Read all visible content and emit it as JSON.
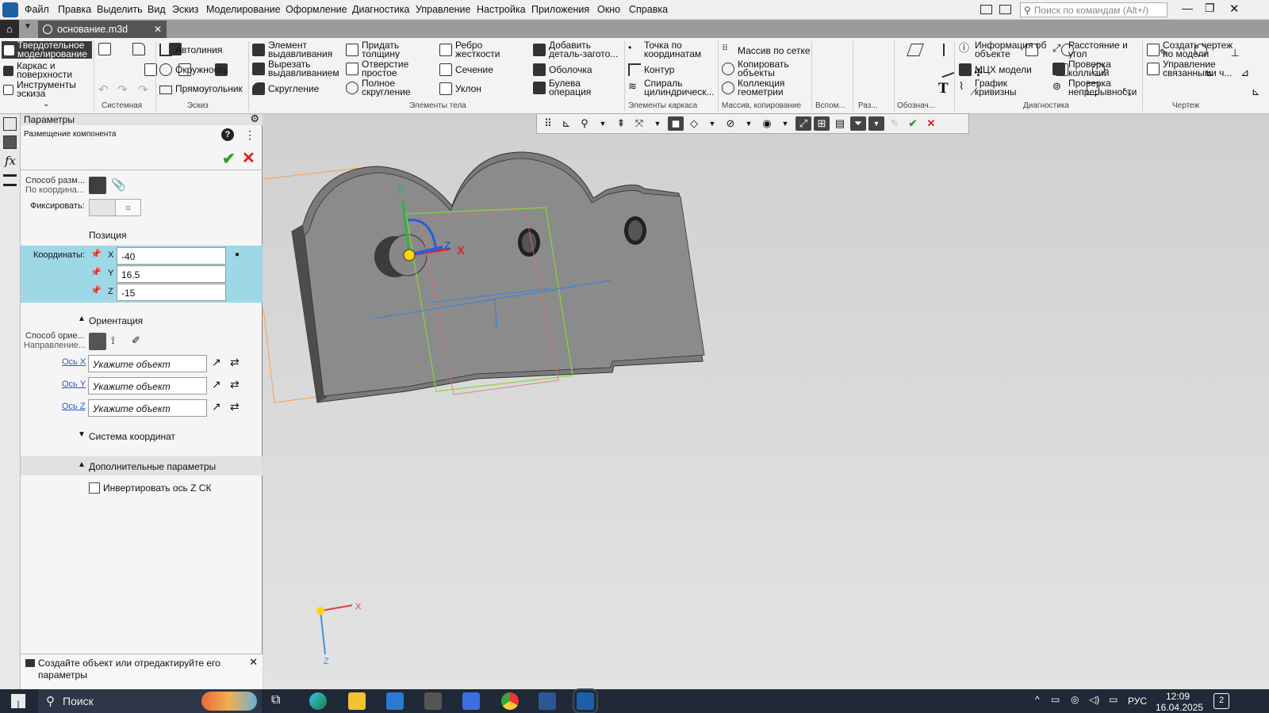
{
  "menu": [
    "Файл",
    "Правка",
    "Выделить",
    "Вид",
    "Эскиз",
    "Моделирование",
    "Оформление",
    "Диагностика",
    "Управление",
    "Настройка",
    "Приложения",
    "Окно",
    "Справка"
  ],
  "search_placeholder": "Поиск по командам (Alt+/)",
  "doc_tab": "основание.m3d",
  "ribbon": {
    "modes": [
      "Твердотельное моделирование",
      "Каркас и поверхности",
      "Инструменты эскиза"
    ],
    "sketch": [
      "Автолиния",
      "Окружность",
      "Прямоугольник"
    ],
    "body1": [
      "Элемент выдавливания",
      "Вырезать выдавливанием",
      "Скругление"
    ],
    "body2": [
      "Придать толщину",
      "Отверстие простое",
      "Полное скругление"
    ],
    "body3": [
      "Ребро жесткости",
      "Сечение",
      "Уклон"
    ],
    "body4": [
      "Добавить деталь-загото...",
      "Оболочка",
      "Булева операция"
    ],
    "wire": [
      "Точка по координатам",
      "Контур",
      "Спираль цилиндрическ..."
    ],
    "array": [
      "Массив по сетке",
      "Копировать объекты",
      "Коллекция геометрии"
    ],
    "diag1": [
      "Информация об объекте",
      "МЦХ модели",
      "График кривизны"
    ],
    "diag2": [
      "Расстояние и угол",
      "Проверка коллизий",
      "Проверка непрерывности"
    ],
    "drawing": [
      "Создать чертеж по модели",
      "Управление связанными ч..."
    ],
    "groups": [
      "Системная",
      "Эскиз",
      "Элементы тела",
      "Элементы каркаса",
      "Массив, копирование",
      "Вспом...",
      "Раз...",
      "Обознач...",
      "Диагностика",
      "Чертеж"
    ]
  },
  "panel": {
    "title": "Параметры",
    "subtitle": "Размещение компонента",
    "placement_label": "Способ разм...",
    "placement_value": "По координа...",
    "fix_label": "Фиксировать:",
    "position_header": "Позиция",
    "coords_label": "Координаты:",
    "coords": {
      "x_axis": "X",
      "x": "-40",
      "y_axis": "Y",
      "y": "16.5",
      "z_axis": "Z",
      "z": "-15"
    },
    "orientation_header": "Ориентация",
    "orient_label": "Способ орие...",
    "orient_value": "Направление...",
    "axes": [
      "Ось X",
      "Ось Y",
      "Ось Z"
    ],
    "axis_placeholder": "Укажите объект",
    "cs_header": "Система координат",
    "extra_header": "Дополнительные параметры",
    "invert_label": "Инвертировать ось Z СК",
    "hint": "Создайте объект или отредактируйте его параметры"
  },
  "viewport": {
    "axis_y": "Y",
    "axis_x": "X",
    "axis_z": "Z",
    "mini_x": "X",
    "mini_z": "Z"
  },
  "taskbar": {
    "search": "Поиск",
    "lang": "РУС",
    "time": "12:09",
    "date": "16.04.2025",
    "notif": "2"
  }
}
